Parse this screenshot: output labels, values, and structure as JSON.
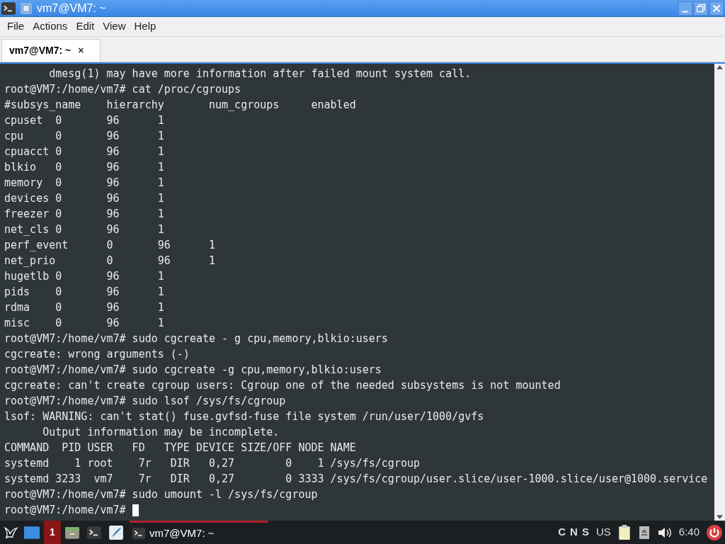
{
  "window": {
    "title": "vm7@VM7: ~"
  },
  "menu": [
    "File",
    "Actions",
    "Edit",
    "View",
    "Help"
  ],
  "tabs": [
    {
      "label": "vm7@VM7: ~",
      "selected": true,
      "close": "×"
    }
  ],
  "terminal": {
    "cursor_visible": true,
    "lines": [
      "       dmesg(1) may have more information after failed mount system call.",
      "root@VM7:/home/vm7# cat /proc/cgroups",
      "#subsys_name    hierarchy       num_cgroups     enabled",
      "cpuset  0       96      1",
      "cpu     0       96      1",
      "cpuacct 0       96      1",
      "blkio   0       96      1",
      "memory  0       96      1",
      "devices 0       96      1",
      "freezer 0       96      1",
      "net_cls 0       96      1",
      "perf_event      0       96      1",
      "net_prio        0       96      1",
      "hugetlb 0       96      1",
      "pids    0       96      1",
      "rdma    0       96      1",
      "misc    0       96      1",
      "root@VM7:/home/vm7# sudo cgcreate - g cpu,memory,blkio:users",
      "cgcreate: wrong arguments (-)",
      "root@VM7:/home/vm7# sudo cgcreate -g cpu,memory,blkio:users",
      "cgcreate: can't create cgroup users: Cgroup one of the needed subsystems is not mounted",
      "root@VM7:/home/vm7# sudo lsof /sys/fs/cgroup",
      "lsof: WARNING: can't stat() fuse.gvfsd-fuse file system /run/user/1000/gvfs",
      "      Output information may be incomplete.",
      "COMMAND  PID USER   FD   TYPE DEVICE SIZE/OFF NODE NAME",
      "systemd    1 root    7r   DIR   0,27        0    1 /sys/fs/cgroup",
      "systemd 3233  vm7    7r   DIR   0,27        0 3333 /sys/fs/cgroup/user.slice/user-1000.slice/user@1000.service",
      "root@VM7:/home/vm7# sudo umount -l /sys/fs/cgroup",
      "root@VM7:/home/vm7# "
    ]
  },
  "taskbar": {
    "workspace": "1",
    "task": "vm7@VM7: ~",
    "indicators": [
      "C",
      "N",
      "S"
    ],
    "layout": "US",
    "clock": "6:40"
  }
}
